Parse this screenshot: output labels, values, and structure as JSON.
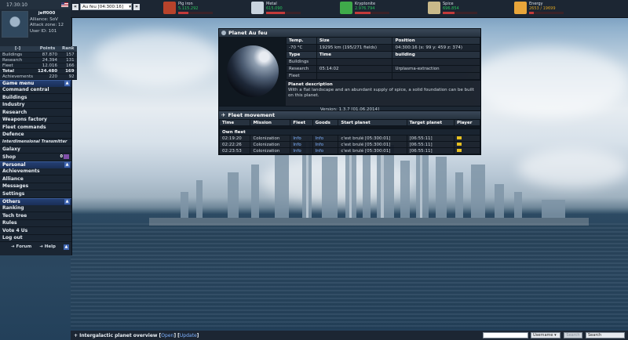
{
  "sidebar": {
    "time": "17:30:10",
    "username": "jeff000",
    "alliance": "Alliance: SoV",
    "attack_zone": "Attack zone: 12",
    "user_id": "User ID: 101",
    "stats_header": [
      "[-]",
      "Points",
      "Rank"
    ],
    "stats": [
      {
        "label": "Buildings",
        "points": "87.870",
        "rank": "157"
      },
      {
        "label": "Research",
        "points": "24.394",
        "rank": "131"
      },
      {
        "label": "Fleet",
        "points": "12.016",
        "rank": "166"
      },
      {
        "label": "Total",
        "points": "124.480",
        "rank": "169"
      },
      {
        "label": "Achievements",
        "points": "220",
        "rank": "92"
      }
    ],
    "sections": [
      {
        "title": "Game menu",
        "items": [
          "Command central",
          "Buildings",
          "Industry",
          "Research",
          "Weapons factory",
          "Fleet commands",
          "Defence",
          "Interdimensional Transmitter",
          "Galaxy",
          "Shop"
        ]
      },
      {
        "title": "Personal",
        "items": [
          "Achievements",
          "Alliance",
          "Messages",
          "Settings"
        ]
      },
      {
        "title": "Others",
        "items": [
          "Ranking",
          "Tech tree",
          "Rules",
          "Vote 4 Us",
          "Log out"
        ]
      }
    ],
    "shop_badge": "0",
    "forum": "Forum",
    "help": "Help"
  },
  "topbar": {
    "planet_select": "Au feu [04:300:16]",
    "resources": [
      {
        "name": "Pig iron",
        "value": "5.115.292",
        "fill": 0.3,
        "color": "#b8432b",
        "icon": "pig-iron-icon",
        "warn": false
      },
      {
        "name": "Metal",
        "value": "615.090",
        "fill": 0.55,
        "color": "#c9d4df",
        "icon": "metal-icon",
        "warn": false
      },
      {
        "name": "Kryptonite",
        "value": "2.976.794",
        "fill": 0.45,
        "color": "#3faa4a",
        "icon": "kryptonite-icon",
        "warn": false
      },
      {
        "name": "Spice",
        "value": "696.854",
        "fill": 0.35,
        "color": "#c9b98a",
        "icon": "spice-icon",
        "warn": false
      },
      {
        "name": "Energy",
        "value": "2653 / 19699",
        "fill": 0.13,
        "color": "#e8a53a",
        "icon": "energy-icon",
        "warn": true
      }
    ]
  },
  "planet": {
    "title": "Planet Au feu",
    "headers1": [
      "Temp.",
      "Size",
      "Position"
    ],
    "temp": "-70 °C",
    "size": "19295 km (195/271 fields)",
    "position": "04:300:16 (x: 99 y: 459 z: 374)",
    "headers2": [
      "Type",
      "Time",
      "building"
    ],
    "rows": [
      {
        "type": "Buildings",
        "time": "",
        "building": ""
      },
      {
        "type": "Research",
        "time": "05:14:02",
        "building": "Urplasma-extraction"
      },
      {
        "type": "Fleet",
        "time": "",
        "building": ""
      }
    ],
    "desc_title": "Planet description",
    "desc_text": "With a flat landscape and an abundant supply of spice, a solid foundation can be built on this planet.",
    "version": "Version: 1.3.7 [01.06.2014]"
  },
  "fleet": {
    "title": "Fleet movement",
    "columns": [
      "Time",
      "Mission",
      "Fleet",
      "Goods",
      "Start planet",
      "Target planet",
      "Player"
    ],
    "own_label": "Own fleet",
    "rows": [
      {
        "time": "02:19:20",
        "mission": "Colonization",
        "fleet": "Info",
        "goods": "Info",
        "start": "c'est brulé [05:300:01]",
        "target": "[06:55:11]"
      },
      {
        "time": "02:22:26",
        "mission": "Colonization",
        "fleet": "Info",
        "goods": "Info",
        "start": "c'est brulé [05:300:01]",
        "target": "[06:55:11]"
      },
      {
        "time": "02:23:53",
        "mission": "Colonization",
        "fleet": "Info",
        "goods": "Info",
        "start": "c'est brulé [05:300:01]",
        "target": "[06:55:11]"
      }
    ]
  },
  "bottombar": {
    "title": "Intergalactic planet overview",
    "open": "Open",
    "update": "Update",
    "search_value": "",
    "username_select": "Username",
    "search_btn": "Search",
    "select2": "Search"
  }
}
